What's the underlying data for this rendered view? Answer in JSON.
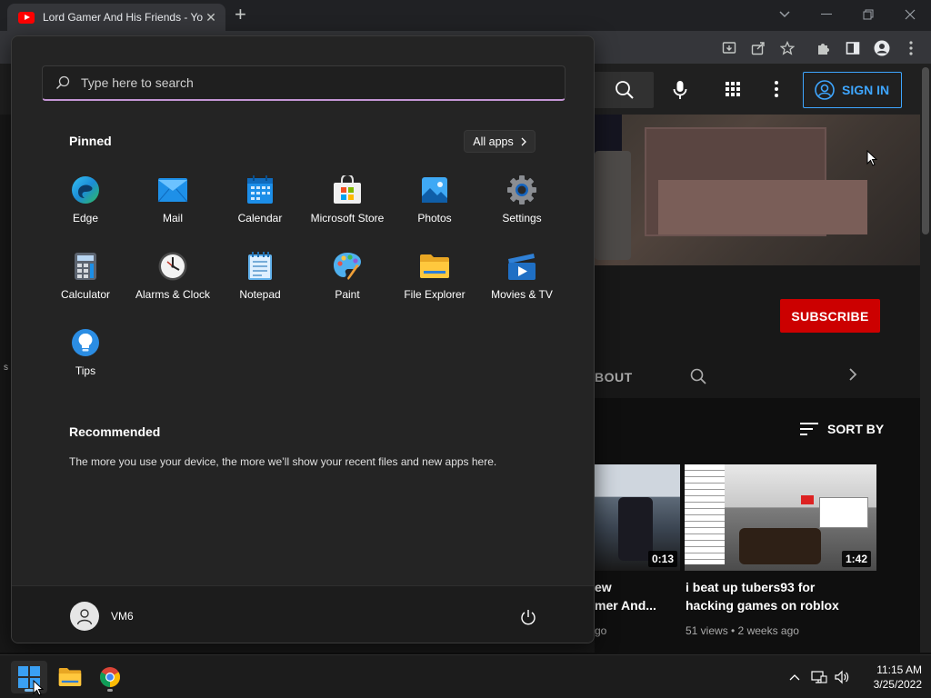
{
  "browser": {
    "tab_title": "Lord Gamer And His Friends - YouTube",
    "new_tab": "+",
    "tab_close": "✕"
  },
  "youtube": {
    "sign_in": "SIGN IN",
    "subscribe": "SUBSCRIBE",
    "about_tab": "BOUT",
    "sort_by": "SORT BY",
    "stray_text": "s",
    "videos": [
      {
        "title_line1": "ew",
        "title_line2": "mer And...",
        "meta": "go",
        "duration": "0:13"
      },
      {
        "title_line1": "i beat up tubers93 for",
        "title_line2": "hacking games on roblox",
        "meta": "51 views • 2 weeks ago",
        "duration": "1:42"
      }
    ]
  },
  "start_menu": {
    "search_placeholder": "Type here to search",
    "pinned_label": "Pinned",
    "all_apps_label": "All apps",
    "apps": [
      {
        "name": "Edge",
        "icon": "edge-icon"
      },
      {
        "name": "Mail",
        "icon": "mail-icon"
      },
      {
        "name": "Calendar",
        "icon": "calendar-icon"
      },
      {
        "name": "Microsoft Store",
        "icon": "store-icon"
      },
      {
        "name": "Photos",
        "icon": "photos-icon"
      },
      {
        "name": "Settings",
        "icon": "settings-icon"
      },
      {
        "name": "Calculator",
        "icon": "calculator-icon"
      },
      {
        "name": "Alarms & Clock",
        "icon": "clock-icon"
      },
      {
        "name": "Notepad",
        "icon": "notepad-icon"
      },
      {
        "name": "Paint",
        "icon": "paint-icon"
      },
      {
        "name": "File Explorer",
        "icon": "folder-icon"
      },
      {
        "name": "Movies & TV",
        "icon": "movies-icon"
      },
      {
        "name": "Tips",
        "icon": "tips-icon"
      }
    ],
    "recommended_label": "Recommended",
    "recommended_text": "The more you use your device, the more we’ll show your recent files and new apps here.",
    "user_name": "VM6"
  },
  "taskbar": {
    "time": "11:15 AM",
    "date": "3/25/2022"
  },
  "colors": {
    "accent": "#c495d4",
    "youtube_red": "#cc0000",
    "link_blue": "#3ea6ff"
  }
}
